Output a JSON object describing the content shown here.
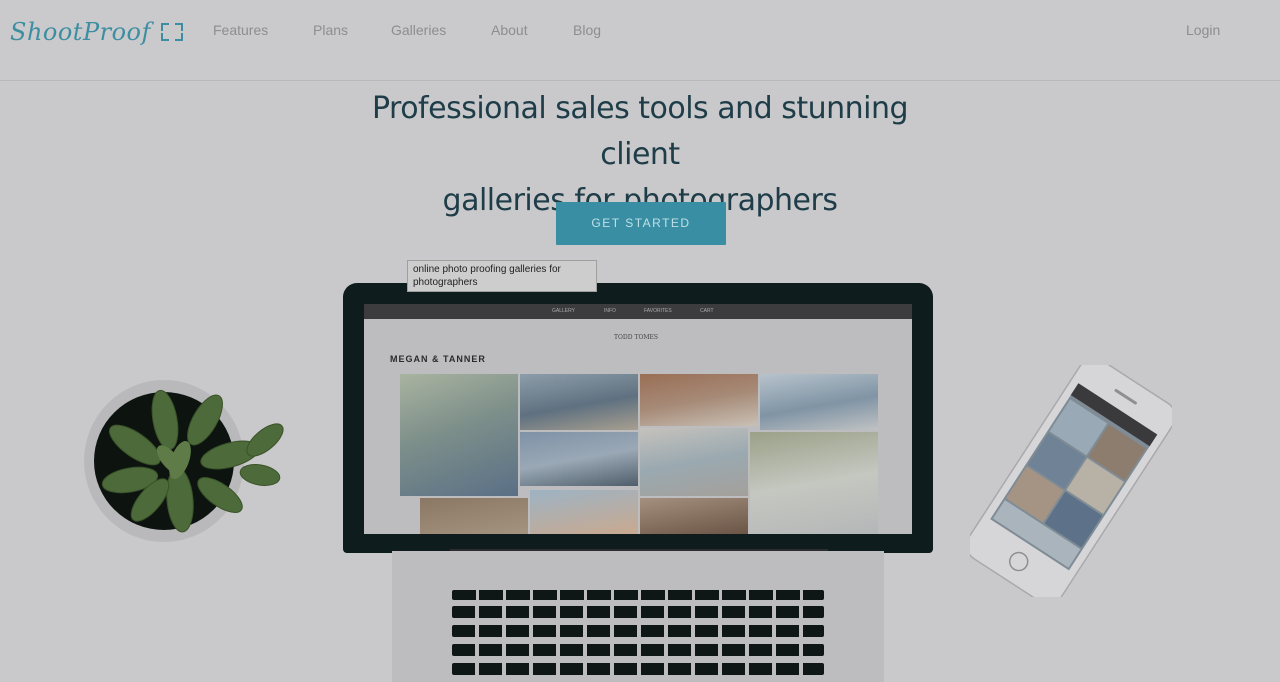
{
  "nav": {
    "logo_text": "ShootProof",
    "items": [
      "Features",
      "Plans",
      "Galleries",
      "About",
      "Blog"
    ],
    "login": "Login"
  },
  "hero": {
    "title_line1": "Professional sales tools and stunning client",
    "title_line2": "galleries for photographers",
    "cta_label": "GET STARTED"
  },
  "tooltip": "online photo proofing galleries for photographers",
  "laptop_screen": {
    "tabs": [
      "GALLERY",
      "INFO",
      "FAVORITES",
      "CART"
    ],
    "brand": "TODD TOMES",
    "gallery_title": "MEGAN & TANNER"
  },
  "colors": {
    "accent": "#3a8ea3",
    "heading": "#1e3d48",
    "nav_text": "#8d8d92"
  }
}
